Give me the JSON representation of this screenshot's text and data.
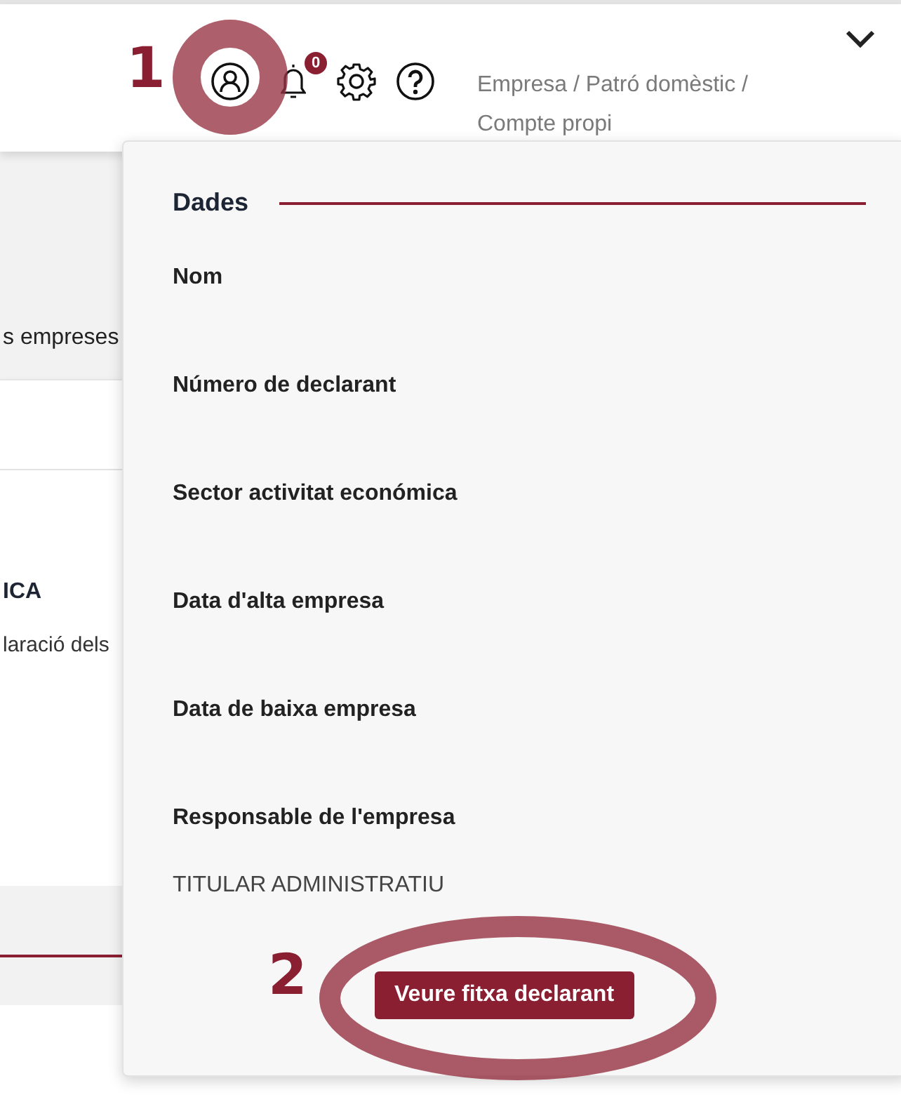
{
  "header": {
    "notification_count": "0",
    "breadcrumb": "Empresa / Patró domèstic / Compte propi"
  },
  "background": {
    "texts": [
      {
        "kind": "plain",
        "text": "s empreses"
      },
      {
        "kind": "heading",
        "text": "ICA"
      },
      {
        "kind": "plain",
        "text": "laració dels"
      }
    ]
  },
  "dropdown": {
    "section_title": "Dades",
    "fields": [
      {
        "label": "Nom"
      },
      {
        "label": "Número de declarant"
      },
      {
        "label": "Sector activitat económica"
      },
      {
        "label": "Data d'alta empresa"
      },
      {
        "label": "Data de baixa empresa"
      },
      {
        "label": "Responsable de l'empresa",
        "value": "TITULAR ADMINISTRATIU"
      }
    ],
    "button": "Veure fitxa declarant"
  },
  "annotations": [
    "1",
    "2"
  ]
}
